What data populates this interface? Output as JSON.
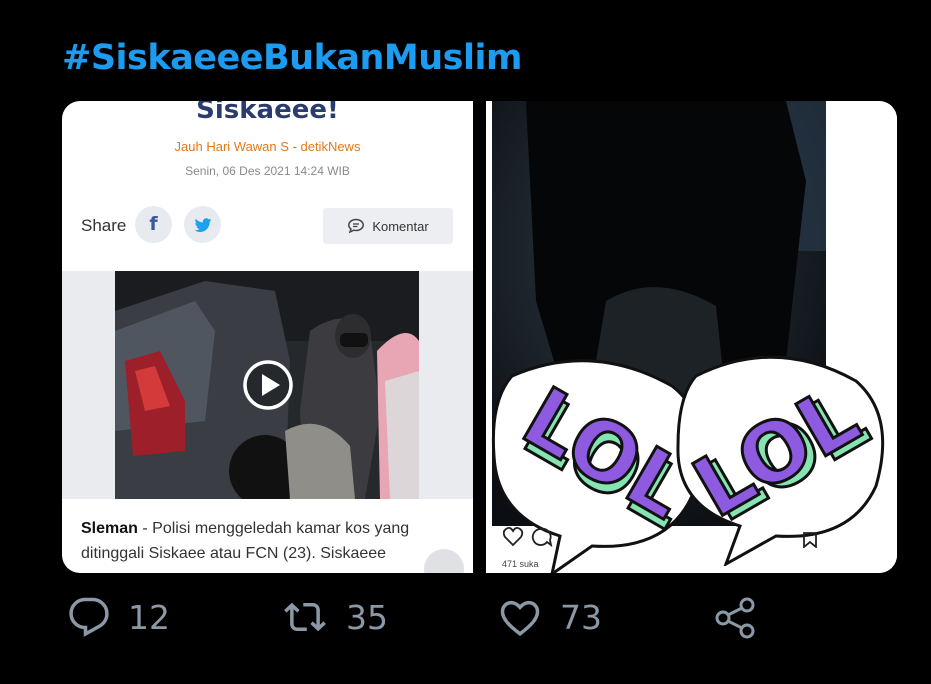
{
  "hashtag": "#SiskaeeeBukanMuslim",
  "article": {
    "title": "Siskaeee!",
    "author": "Jauh Hari Wawan S - detikNews",
    "date": "Senin, 06 Des 2021 14:24 WIB",
    "share_label": "Share",
    "facebook_glyph": "f",
    "comment_button": "Komentar",
    "location": "Sleman",
    "body": " - Polisi menggeledah kamar kos yang ditinggali Siskaee atau FCN (23). Siskaeee"
  },
  "instagram": {
    "sticker_text": "LOL",
    "likes": "471 suka",
    "sticker_colors": {
      "purple": "#8e5ae0",
      "mint": "#86e4b3"
    }
  },
  "actions": {
    "replies": "12",
    "retweets": "35",
    "likes": "73"
  },
  "colors": {
    "hashtag": "#1d9bf0",
    "action_icon": "#8b98a5"
  }
}
